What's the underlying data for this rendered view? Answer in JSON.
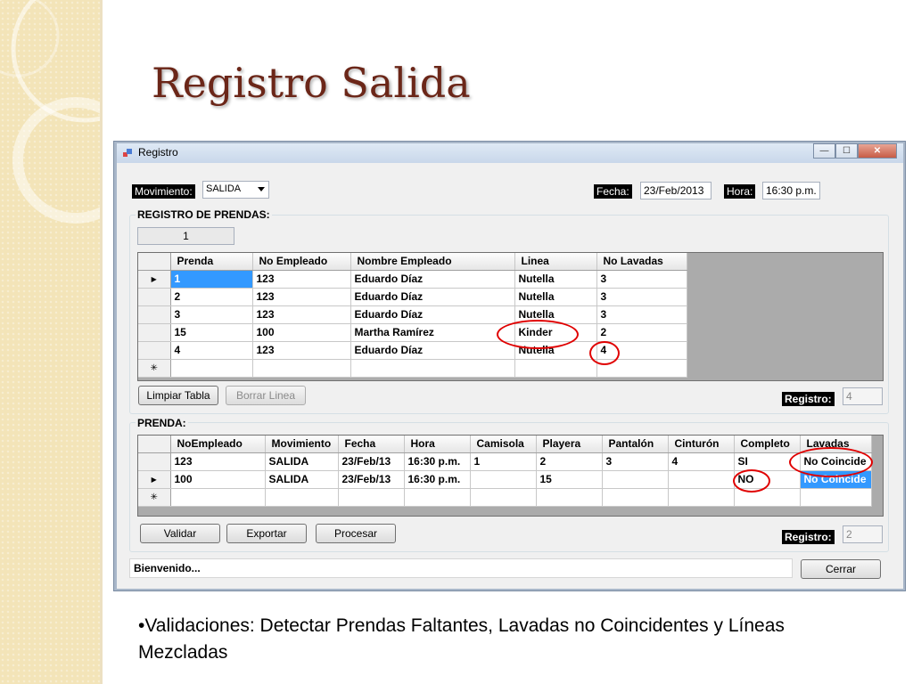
{
  "slide": {
    "title": "Registro Salida",
    "bullet_mark": "•",
    "bullet_text": "Validaciones: Detectar Prendas Faltantes, Lavadas no Coincidentes y Líneas Mezcladas"
  },
  "window": {
    "title": "Registro",
    "minimize_label": "—",
    "maximize_label": "☐",
    "close_label": "✕"
  },
  "header": {
    "movimiento_label": "Movimiento:",
    "movimiento_value": "SALIDA",
    "fecha_label": "Fecha:",
    "fecha_value": "23/Feb/2013",
    "hora_label": "Hora:",
    "hora_value": "16:30 p.m."
  },
  "registro_prendas": {
    "title": "REGISTRO DE PRENDAS:",
    "counter": "1",
    "columns": [
      "Prenda",
      "No Empleado",
      "Nombre Empleado",
      "Linea",
      "No Lavadas"
    ],
    "rows": [
      [
        "1",
        "123",
        "Eduardo Díaz",
        "Nutella",
        "3"
      ],
      [
        "2",
        "123",
        "Eduardo Díaz",
        "Nutella",
        "3"
      ],
      [
        "3",
        "123",
        "Eduardo Díaz",
        "Nutella",
        "3"
      ],
      [
        "15",
        "100",
        "Martha Ramírez",
        "Kinder",
        "2"
      ],
      [
        "4",
        "123",
        "Eduardo Díaz",
        "Nutella",
        "4"
      ]
    ],
    "current_row_marker": "▶",
    "new_row_marker": "✳",
    "limpiar_label": "Limpiar Tabla",
    "borrar_label": "Borrar Linea",
    "registro_label": "Registro:",
    "registro_value": "4"
  },
  "prenda": {
    "title": "PRENDA:",
    "columns": [
      "NoEmpleado",
      "Movimiento",
      "Fecha",
      "Hora",
      "Camisola",
      "Playera",
      "Pantalón",
      "Cinturón",
      "Completo",
      "Lavadas"
    ],
    "rows": [
      [
        "123",
        "SALIDA",
        "23/Feb/13",
        "16:30 p.m.",
        "1",
        "2",
        "3",
        "4",
        "SI",
        "No Coincide"
      ],
      [
        "100",
        "SALIDA",
        "23/Feb/13",
        "16:30 p.m.",
        "",
        "15",
        "",
        "",
        "NO",
        "No Coincide"
      ]
    ],
    "registro_label": "Registro:",
    "registro_value": "2"
  },
  "buttons": {
    "validar": "Validar",
    "exportar": "Exportar",
    "procesar": "Procesar",
    "cerrar": "Cerrar"
  },
  "status": {
    "message": "Bienvenido..."
  },
  "colors": {
    "title": "#6b2618",
    "sidebar": "#f3e4b8",
    "selection": "#3399ff",
    "highlight": "#e00000"
  }
}
